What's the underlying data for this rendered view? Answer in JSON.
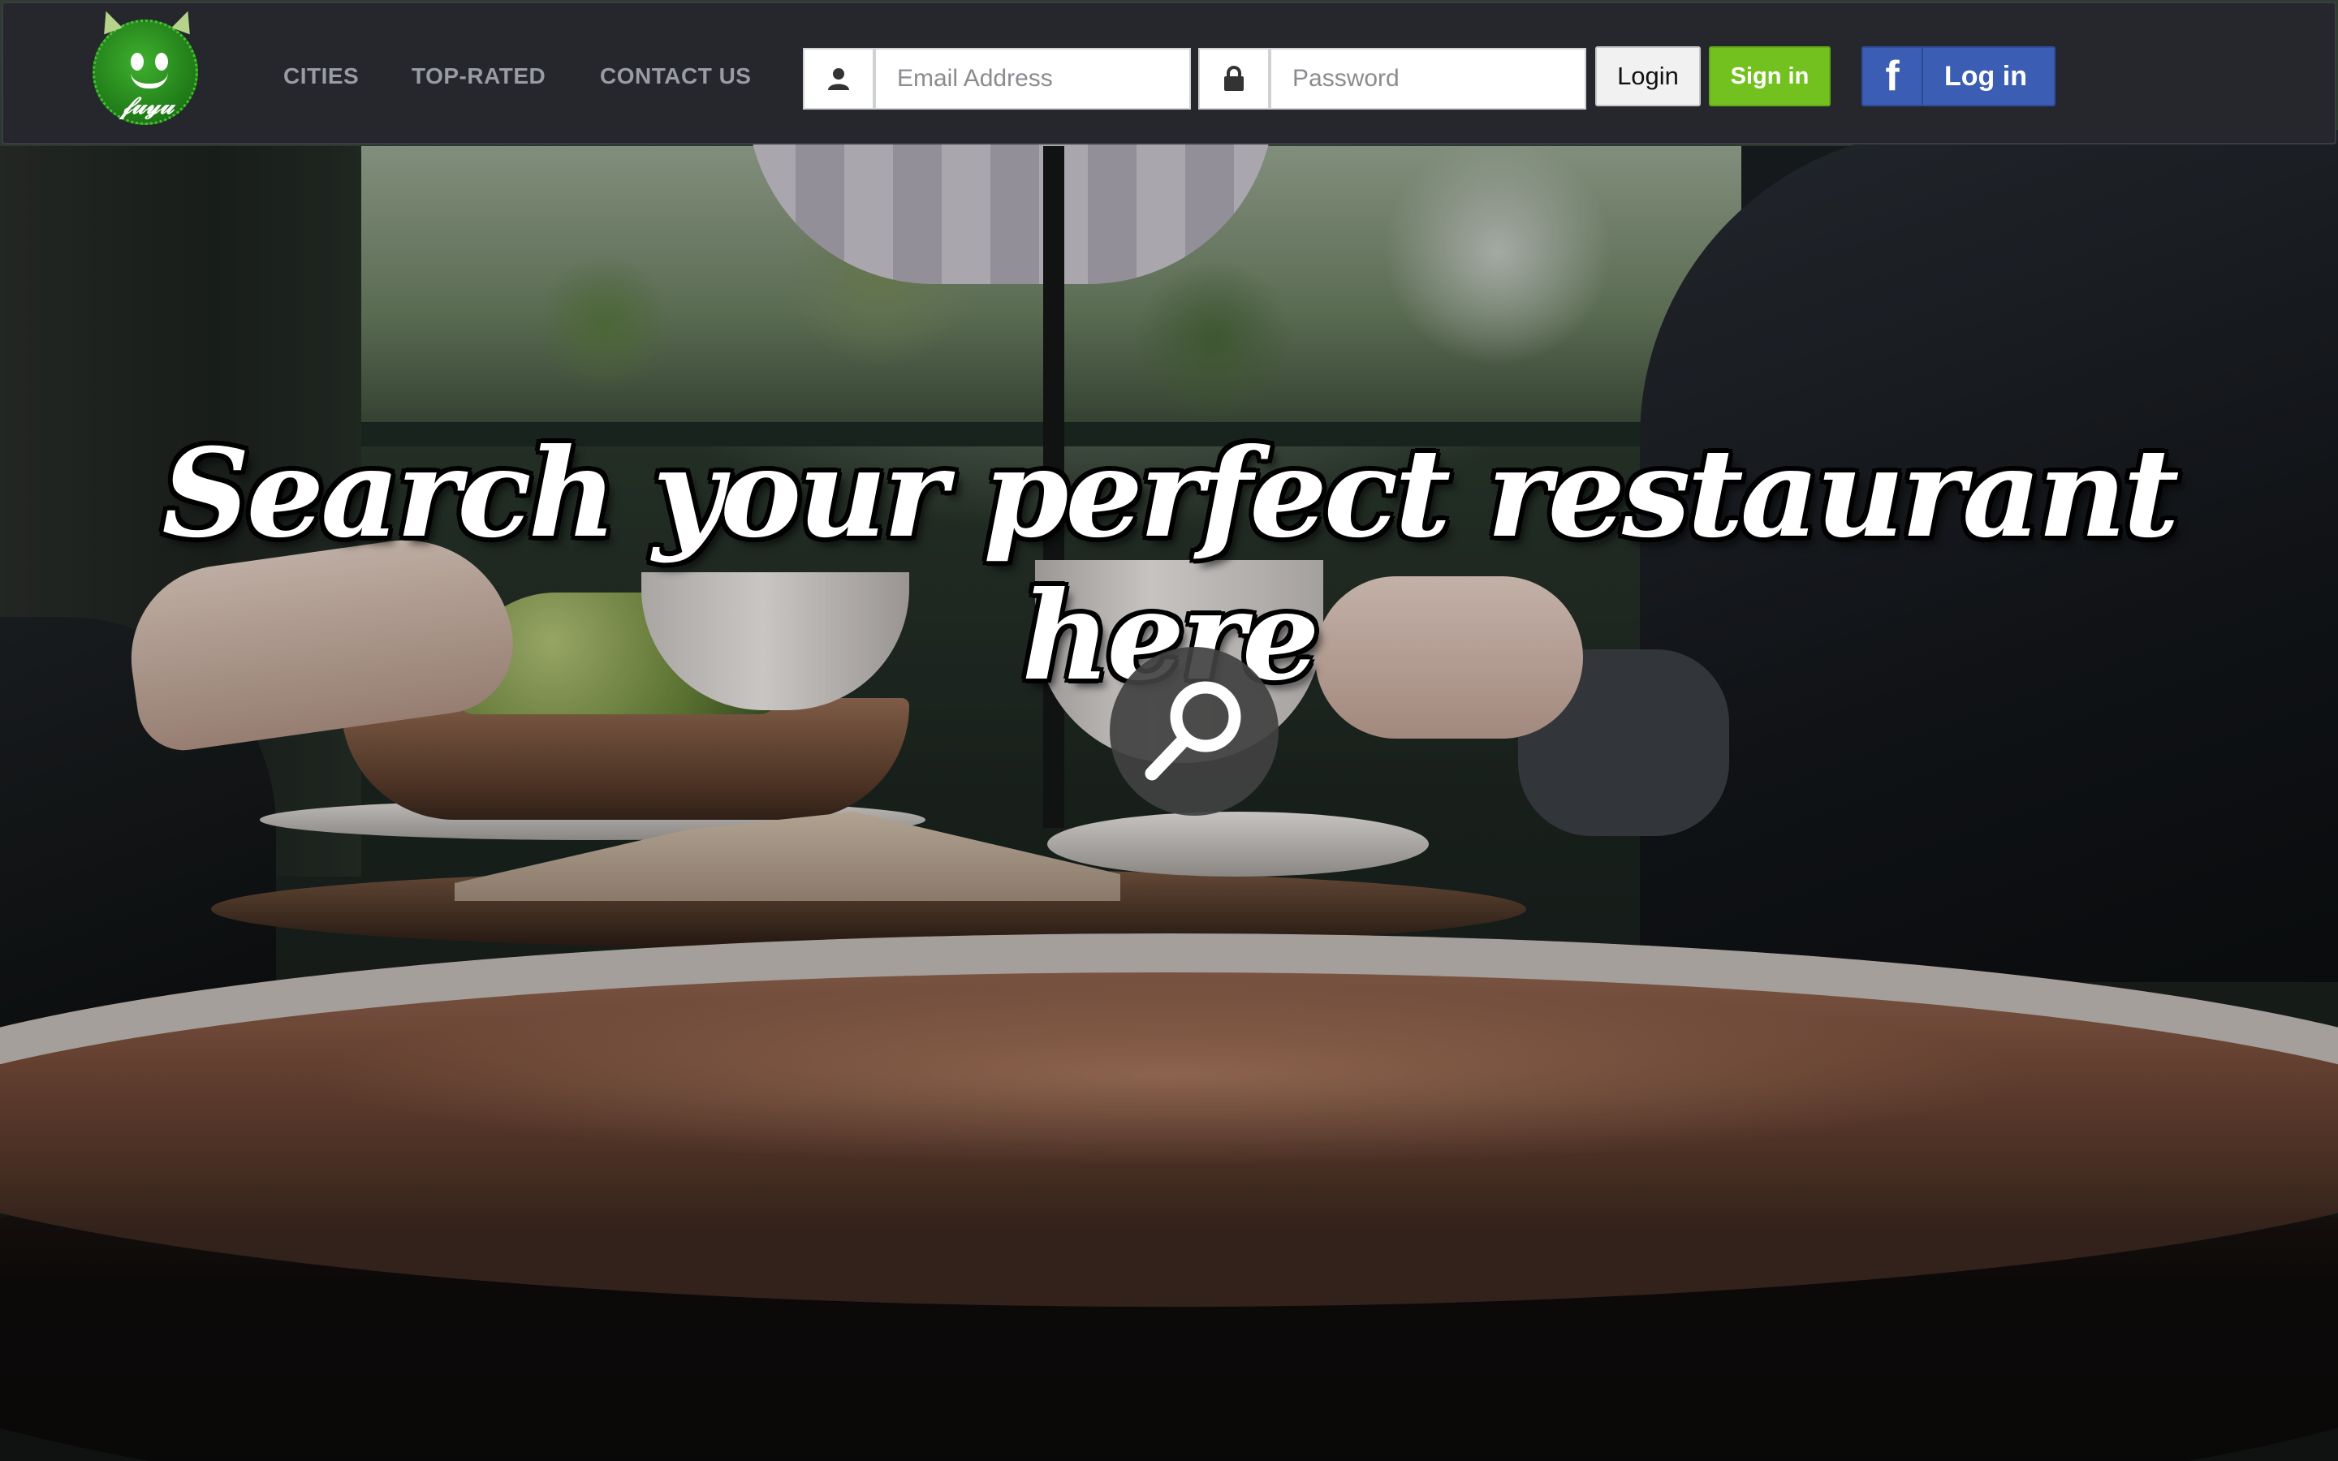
{
  "brand": {
    "logo_icon": "green-blob-mascot-logo",
    "logo_script": "𝒻𝓊𝓎𝓊"
  },
  "nav": {
    "links": [
      "CITIES",
      "TOP-RATED",
      "CONTACT US"
    ]
  },
  "auth": {
    "email_icon": "user-icon",
    "email_placeholder": "Email Address",
    "password_icon": "lock-icon",
    "password_placeholder": "Password",
    "login_label": "Login",
    "signin_label": "Sign in",
    "facebook_icon": "facebook-icon",
    "facebook_glyph": "f",
    "facebook_label": "Log in"
  },
  "hero": {
    "headline": "Search your perfect restaurant here",
    "search_icon": "magnifier-icon"
  },
  "colors": {
    "navbar_bg": "#25272d",
    "signin_green": "#72c11f",
    "facebook_blue": "#3b5db3",
    "nav_link_gray": "#9a9ca3"
  }
}
